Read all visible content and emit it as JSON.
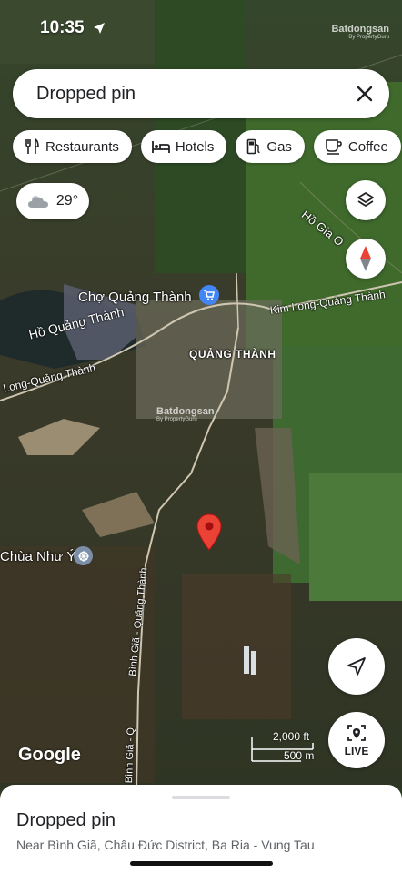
{
  "status_bar": {
    "time": "10:35"
  },
  "watermark": {
    "brand": "Batdongsan",
    "sub": "By PropertyGuru"
  },
  "search": {
    "value": "Dropped pin"
  },
  "chips": [
    {
      "label": "Restaurants",
      "icon": "fork-knife-icon"
    },
    {
      "label": "Hotels",
      "icon": "bed-icon"
    },
    {
      "label": "Gas",
      "icon": "gas-pump-icon"
    },
    {
      "label": "Coffee",
      "icon": "coffee-cup-icon"
    }
  ],
  "weather": {
    "temp": "29°",
    "icon": "cloud-icon"
  },
  "map_labels": {
    "market": "Chợ Quảng Thành",
    "district": "QUẢNG THÀNH",
    "lake": "Hồ Quảng Thành",
    "road_ne": "Kim Long-Quảng Thành",
    "road_w": "Long-Quảng Thành",
    "lake_ne": "Hồ Gia O",
    "pagoda": "Chùa Như Ý",
    "road_s1": "Bình Giã - Quảng Thành",
    "road_s2": "Bình Giã - Q"
  },
  "scale": {
    "imperial": "2,000 ft",
    "metric": "500 m"
  },
  "google_logo": "Google",
  "live_label": "LIVE",
  "place": {
    "title": "Dropped pin",
    "subtitle": "Near Bình Giã, Châu Đức District, Ba Ria - Vung Tau"
  },
  "colors": {
    "pin": "#ea4335",
    "compass_red": "#ea4335"
  }
}
